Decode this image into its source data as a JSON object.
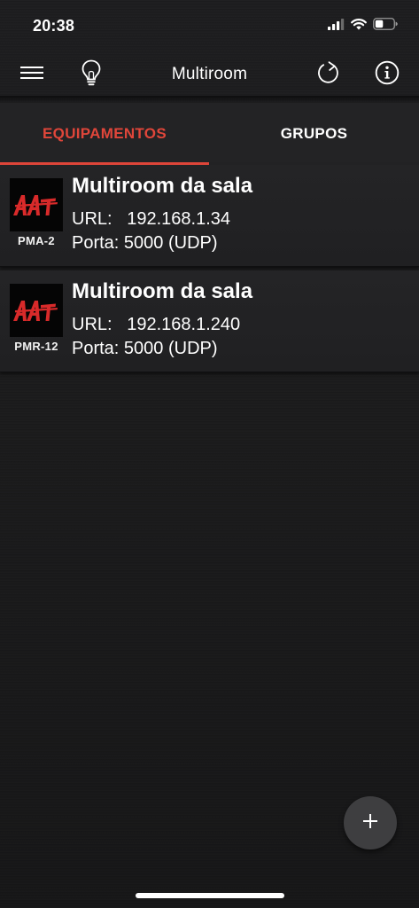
{
  "status_bar": {
    "time": "20:38",
    "icons": [
      "cellular-signal-icon",
      "wifi-icon",
      "battery-icon"
    ]
  },
  "app_bar": {
    "title": "Multiroom",
    "left_icons": [
      "hamburger-menu-icon",
      "lightbulb-icon"
    ],
    "right_icons": [
      "refresh-icon",
      "info-icon"
    ]
  },
  "tabs": [
    {
      "label": "EQUIPAMENTOS",
      "active": true
    },
    {
      "label": "GRUPOS",
      "active": false
    }
  ],
  "devices": [
    {
      "name": "Multiroom da sala",
      "model": "PMA-2",
      "url": "URL:   192.168.1.34",
      "port": "Porta: 5000 (UDP)"
    },
    {
      "name": "Multiroom da sala",
      "model": "PMR-12",
      "url": "URL:   192.168.1.240",
      "port": "Porta: 5000 (UDP)"
    }
  ],
  "fab": {
    "icon": "plus-icon"
  },
  "colors": {
    "accent": "#e0463a",
    "background": "#1b1b1c",
    "card": "#232325",
    "fab": "#3e3e40"
  }
}
